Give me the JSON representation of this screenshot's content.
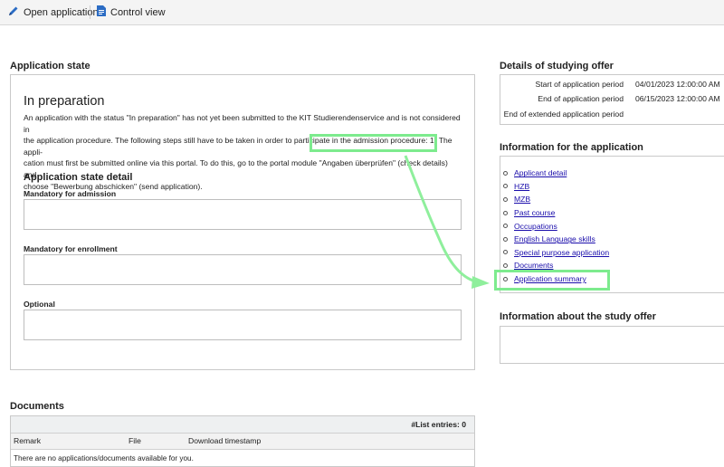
{
  "toolbar": {
    "open_application": "Open application",
    "control_view": "Control view"
  },
  "application_state": {
    "title": "Application state",
    "status": "In preparation",
    "description": [
      "An application with the status \"In preparation\" has not yet been submitted to the KIT Studierendenservice and is not considered in",
      "the application procedure. The following steps still have to be taken in order to participate in the admission procedure: 1) The appli-",
      "cation must first be submitted online via this portal. To do this, go to the portal module \"Angaben überprüfen\" (check details) and",
      "choose \"Bewerbung abschicken\" (send application)."
    ],
    "detail_title": "Application state detail",
    "mandatory_admission": "Mandatory for admission",
    "mandatory_enrollment": "Mandatory for enrollment",
    "optional": "Optional"
  },
  "studying_offer": {
    "title": "Details of studying offer",
    "rows": [
      {
        "label": "Start of application period",
        "value": "04/01/2023 12:00:00 AM"
      },
      {
        "label": "End of application period",
        "value": "06/15/2023 12:00:00 AM"
      },
      {
        "label": "End of extended application period",
        "value": ""
      }
    ]
  },
  "information": {
    "title": "Information for the application",
    "links": [
      "Applicant detail",
      "HZB",
      "MZB",
      "Past course",
      "Occupations",
      "English Language skills",
      "Special purpose application",
      "Documents",
      "Application summary"
    ]
  },
  "study_offer_info": {
    "title": "Information about the study offer"
  },
  "documents": {
    "title": "Documents",
    "count_label": "#List entries: 0",
    "columns": [
      "Remark",
      "File",
      "Download timestamp"
    ],
    "empty_message": "There are no applications/documents available for you."
  },
  "colors": {
    "highlight": "#7deb8e",
    "link": "#1a0dab"
  }
}
